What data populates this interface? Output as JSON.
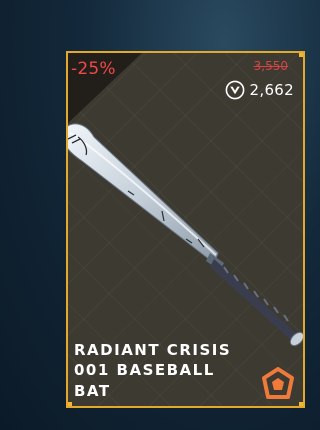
{
  "item": {
    "name": "RADIANT CRISIS 001 BASEBALL BAT",
    "discount": "-25%",
    "original_price": "3,550",
    "price": "2,662",
    "currency_icon": "valorant-points-icon",
    "tier_icon": "premium-tier-icon"
  },
  "colors": {
    "border": "#e4a92c",
    "discount": "#f04848",
    "original_price": "#d34545",
    "tier": "#f07a3a"
  }
}
